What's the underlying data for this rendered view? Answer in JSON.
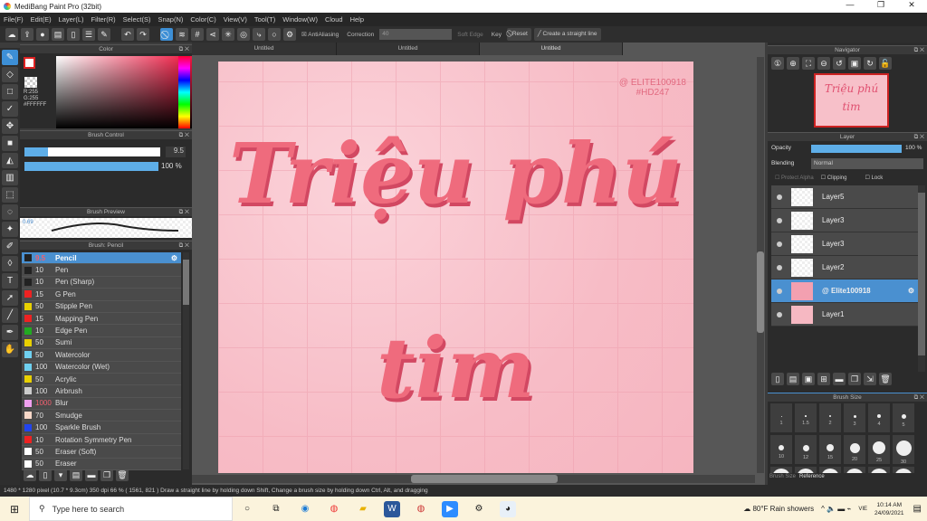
{
  "window": {
    "title": "MediBang Paint Pro (32bit)",
    "min": "—",
    "max": "❐",
    "close": "✕"
  },
  "menu": [
    "File(F)",
    "Edit(E)",
    "Layer(L)",
    "Filter(R)",
    "Select(S)",
    "Snap(N)",
    "Color(C)",
    "View(V)",
    "Tool(T)",
    "Window(W)",
    "Cloud",
    "Help"
  ],
  "toolbar": {
    "antialiasing": "AntiAliasing",
    "correction_label": "Correction",
    "correction_value": "40",
    "soft_edge": "Soft Edge",
    "key": "Key",
    "reset": "Reset",
    "straight_line": "Create a straight line"
  },
  "color_panel": {
    "title": "Color",
    "r": "R:255",
    "g": "G:255",
    "hex": "#FFFFFF"
  },
  "brush_control": {
    "title": "Brush Control",
    "size": "9.5",
    "size_fraction": 0.17,
    "opacity": "100 %",
    "opacity_fraction": 1.0
  },
  "brush_preview": {
    "title": "Brush Preview",
    "value": "0.69"
  },
  "brush_panel": {
    "title": "Brush: Pencil",
    "items": [
      {
        "size": "9.5",
        "name": "Pencil",
        "color": "#222222",
        "selected": true
      },
      {
        "size": "10",
        "name": "Pen",
        "color": "#222222"
      },
      {
        "size": "10",
        "name": "Pen (Sharp)",
        "color": "#222222"
      },
      {
        "size": "15",
        "name": "G Pen",
        "color": "#ee2222"
      },
      {
        "size": "50",
        "name": "Stipple Pen",
        "color": "#e8d000"
      },
      {
        "size": "15",
        "name": "Mapping Pen",
        "color": "#ee2222"
      },
      {
        "size": "10",
        "name": "Edge Pen",
        "color": "#22aa22"
      },
      {
        "size": "50",
        "name": "Sumi",
        "color": "#e8d000"
      },
      {
        "size": "50",
        "name": "Watercolor",
        "color": "#6fd0f0"
      },
      {
        "size": "100",
        "name": "Watercolor (Wet)",
        "color": "#6fd0f0"
      },
      {
        "size": "50",
        "name": "Acrylic",
        "color": "#e8d000"
      },
      {
        "size": "100",
        "name": "Airbrush",
        "color": "#cccccc"
      },
      {
        "size": "1000",
        "name": "Blur",
        "color": "#f0a0f0"
      },
      {
        "size": "70",
        "name": "Smudge",
        "color": "#f8d8c8"
      },
      {
        "size": "100",
        "name": "Sparkle Brush",
        "color": "#2244ee"
      },
      {
        "size": "10",
        "name": "Rotation Symmetry Pen",
        "color": "#ee2222"
      },
      {
        "size": "50",
        "name": "Eraser (Soft)",
        "color": "#ffffff"
      },
      {
        "size": "50",
        "name": "Eraser",
        "color": "#ffffff"
      }
    ]
  },
  "tabs": [
    "Untitled",
    "Untitled",
    "Untitled"
  ],
  "artwork": {
    "line1": "Triệu phú",
    "line2": "tim",
    "watermark1": "@ ELITE100918",
    "watermark2": "#HD247"
  },
  "navigator": {
    "title": "Navigator"
  },
  "layer_panel": {
    "title": "Layer",
    "opacity_label": "Opacity",
    "opacity": "100 %",
    "opacity_fraction": 1.0,
    "blending_label": "Blending",
    "blending": "Normal",
    "protect_alpha": "Protect Alpha",
    "clipping": "Clipping",
    "lock": "Lock",
    "layers": [
      {
        "name": "Layer5"
      },
      {
        "name": "Layer3"
      },
      {
        "name": "Layer3"
      },
      {
        "name": "Layer2"
      },
      {
        "name": "@ Elite100918",
        "selected": true
      },
      {
        "name": "Layer1"
      }
    ]
  },
  "brush_size": {
    "title": "Brush Size",
    "sizes": [
      "1",
      "1.5",
      "2",
      "3",
      "4",
      "5",
      "10",
      "12",
      "15",
      "20",
      "25",
      "30"
    ],
    "tab1": "Brush Size",
    "tab2": "Reference"
  },
  "status": "1480 * 1280 pixel  (10.7 * 9.3cm)  350 dpi  66 %  ( 1561, 821 )  Draw a straight line by holding down Shift, Change a brush size by holding down Ctrl, Alt, and dragging",
  "taskbar": {
    "search": "Type here to search",
    "weather": "80°F  Rain showers",
    "lang": "VIE",
    "time": "10:14 AM",
    "date": "24/09/2021"
  }
}
